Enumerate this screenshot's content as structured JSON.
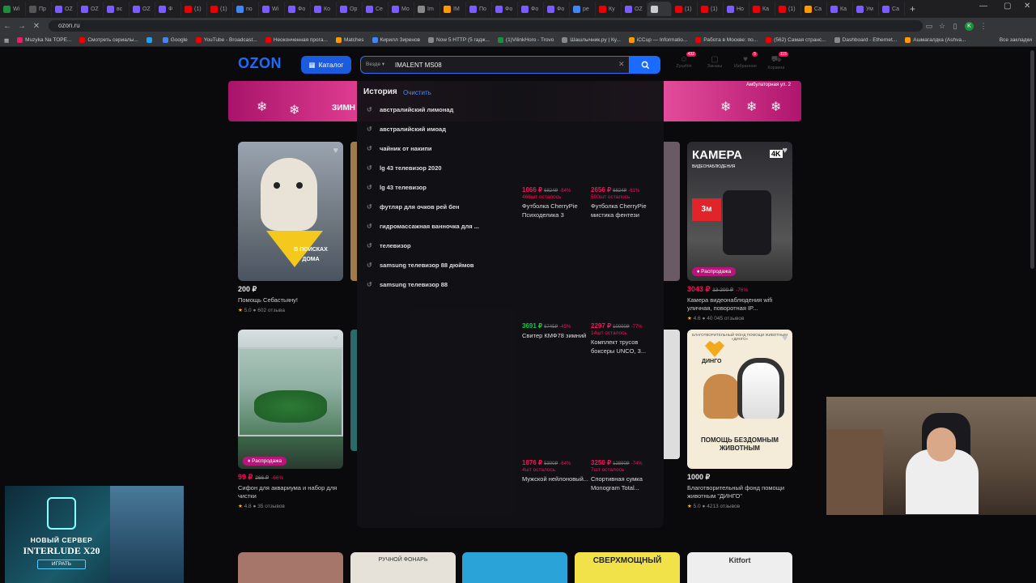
{
  "browser": {
    "tabs": [
      "Wi",
      "Пр",
      "OZ",
      "OZ",
      "вс",
      "OZ",
      "Ф",
      "(1)",
      "(1)",
      "по",
      "Wi",
      "Фо",
      "Ко",
      "Ор",
      "Се",
      "Мо",
      "Im",
      "IM",
      "По",
      "Фо",
      "Фо",
      "Фо",
      "ре",
      "Ку",
      "OZ",
      "",
      "(1)",
      "(1)",
      "Но",
      "Ка",
      "(1)",
      "Са",
      "Ка",
      "Ум",
      "Са"
    ],
    "tab_colors": [
      "#1e8e3e",
      "#555",
      "#7b5cff",
      "#7b5cff",
      "#7b5cff",
      "#7b5cff",
      "#7b5cff",
      "#e00",
      "#e00",
      "#4285f4",
      "#7b5cff",
      "#7b5cff",
      "#7b5cff",
      "#7b5cff",
      "#7b5cff",
      "#7b5cff",
      "#888",
      "#f90",
      "#7b5cff",
      "#7b5cff",
      "#7b5cff",
      "#7b5cff",
      "#4285f4",
      "#e00",
      "#7b5cff",
      "#ccc",
      "#e00",
      "#e00",
      "#7b5cff",
      "#e00",
      "#e00",
      "#f90",
      "#7b5cff",
      "#7b5cff",
      "#7b5cff"
    ],
    "active_tab": 25,
    "new_tab": "+",
    "url": "ozon.ru",
    "profile_initial": "K",
    "bookmarks": [
      "Muzyka Na TOPE...",
      "Смотреть сериалы...",
      "",
      "Google",
      "YouTube - Broadcast...",
      "Неоконченная прога...",
      "Matches",
      "Кирилл Зиренов",
      "Now 5 HTTP (5 гадж...",
      "(1)VilinkHoro - Trovo",
      "Шашлычник.ру | Ку...",
      "iCCup — Informatio...",
      "Работа в Москве: по...",
      "(562) Самая странс...",
      "Dashboard - Ethernet...",
      "Ашмагалдка (Ashva..."
    ],
    "bookmark_colors": [
      "#e91e63",
      "#e00",
      "#1da1f2",
      "#4285f4",
      "#e00",
      "#e00",
      "#f90",
      "#4285f4",
      "#888",
      "#1e8e3e",
      "#888",
      "#f90",
      "#e00",
      "#e00",
      "#888",
      "#f90"
    ],
    "all_bookmarks": "Все закладки"
  },
  "ozon": {
    "logo": "OZON",
    "catalog": "Каталог",
    "search_scope": "Везде",
    "search_value": "IMALENT MS08",
    "header_icons": [
      {
        "label": "Zyuzhin",
        "badge": "432"
      },
      {
        "label": "Заказы",
        "badge": ""
      },
      {
        "label": "Избранное",
        "badge": "5"
      },
      {
        "label": "Корзина",
        "badge": "115"
      }
    ],
    "banner_text": "ЗИМН",
    "banner_sub": "Амбулаторная ул. 2"
  },
  "history": {
    "title": "История",
    "clear": "Очистить",
    "items": [
      "австралийский лимонад",
      "австралийский имоад",
      "чайник от накипи",
      "lg 43 телевизор 2020",
      "lg 43 телевизор",
      "футляр для очков рей бен",
      "гидромассажная ванночка для ...",
      "телевизор",
      "samsung телевизор 88 дюймов",
      "samsung телевизор 88"
    ]
  },
  "dropdown_products": [
    {
      "price": "1066 ₽",
      "old": "6824₽",
      "disc": "-84%",
      "left": "466шт осталось",
      "title": "Футболка CherryPie Психоделика 3",
      "price_color": "#f91155"
    },
    {
      "price": "2656 ₽",
      "old": "6824₽",
      "disc": "-61%",
      "left": "500шт осталось",
      "title": "Футболка CherryPie мистика фентези",
      "price_color": "#f91155"
    },
    {
      "price": "3691 ₽",
      "old": "6745₽",
      "disc": "-45%",
      "left": "",
      "title": "Свитер КМФ78 зимний",
      "price_color": "#10c44c"
    },
    {
      "price": "2297 ₽",
      "old": "10000₽",
      "disc": "-77%",
      "left": "14шт осталось",
      "title": "Комплект трусов боксеры UNCO, 3...",
      "price_color": "#f91155"
    },
    {
      "price": "1876 ₽",
      "old": "5300₽",
      "disc": "-64%",
      "left": "4шт осталось",
      "title": "Мужской нейлоновый...",
      "price_color": "#f91155"
    },
    {
      "price": "3250 ₽",
      "old": "12890₽",
      "disc": "-74%",
      "left": "7шт осталось",
      "title": "Спортивная сумка Monogram Total...",
      "price_color": "#f91155"
    }
  ],
  "cards": [
    {
      "price": "200 ₽",
      "old": "",
      "disc": "",
      "title": "Помощь Себастьяну!",
      "rating": "5.0",
      "reviews": "602 отзыва",
      "sale": "",
      "img_text": "В ПОИСКАХ ДОМА"
    },
    {
      "price": "3043 ₽",
      "old": "13 200 ₽",
      "disc": "-76%",
      "title": "Камера видеонаблюдения wifi уличная, поворотная IP...",
      "rating": "4.6",
      "reviews": "40 045 отзывов",
      "sale": "Распродажа",
      "img_text": "КАМЕРА"
    },
    {
      "price": "99 ₽",
      "old": "266 ₽",
      "disc": "-66%",
      "title": "Сифон для аквариума и набор для чистки",
      "rating": "4.8",
      "reviews": "35 отзывов",
      "sale": "Распродажа",
      "img_text": ""
    },
    {
      "price": "1000 ₽",
      "old": "",
      "disc": "",
      "title": "Благотворительный фонд помощи животным \"ДИНГО\"",
      "rating": "5.0",
      "reviews": "4213 отзывов",
      "sale": "",
      "img_text": "ПОМОЩЬ БЕЗДОМНЫМ ЖИВОТНЫМ"
    }
  ],
  "bottom_strip": [
    "РУЧНОЙ ФОНАРЬ",
    "СВЕРХМОЩНЫЙ",
    "Kitfort"
  ],
  "promo": {
    "line1": "НОВЫЙ СЕРВЕР",
    "line2": "INTERLUDE X20",
    "button": "ИГРАТЬ"
  },
  "camera_card": {
    "subtitle": "ВИДЕОНАБЛЮДЕНИЯ",
    "badge_4k": "4K"
  },
  "dingo_card": {
    "org": "БЛАГОТВОРИТЕЛЬНЫЙ ФОНД ПОМОЩИ ЖИВОТНЫМ «ДИНГО»",
    "logo": "ДИНГО"
  }
}
